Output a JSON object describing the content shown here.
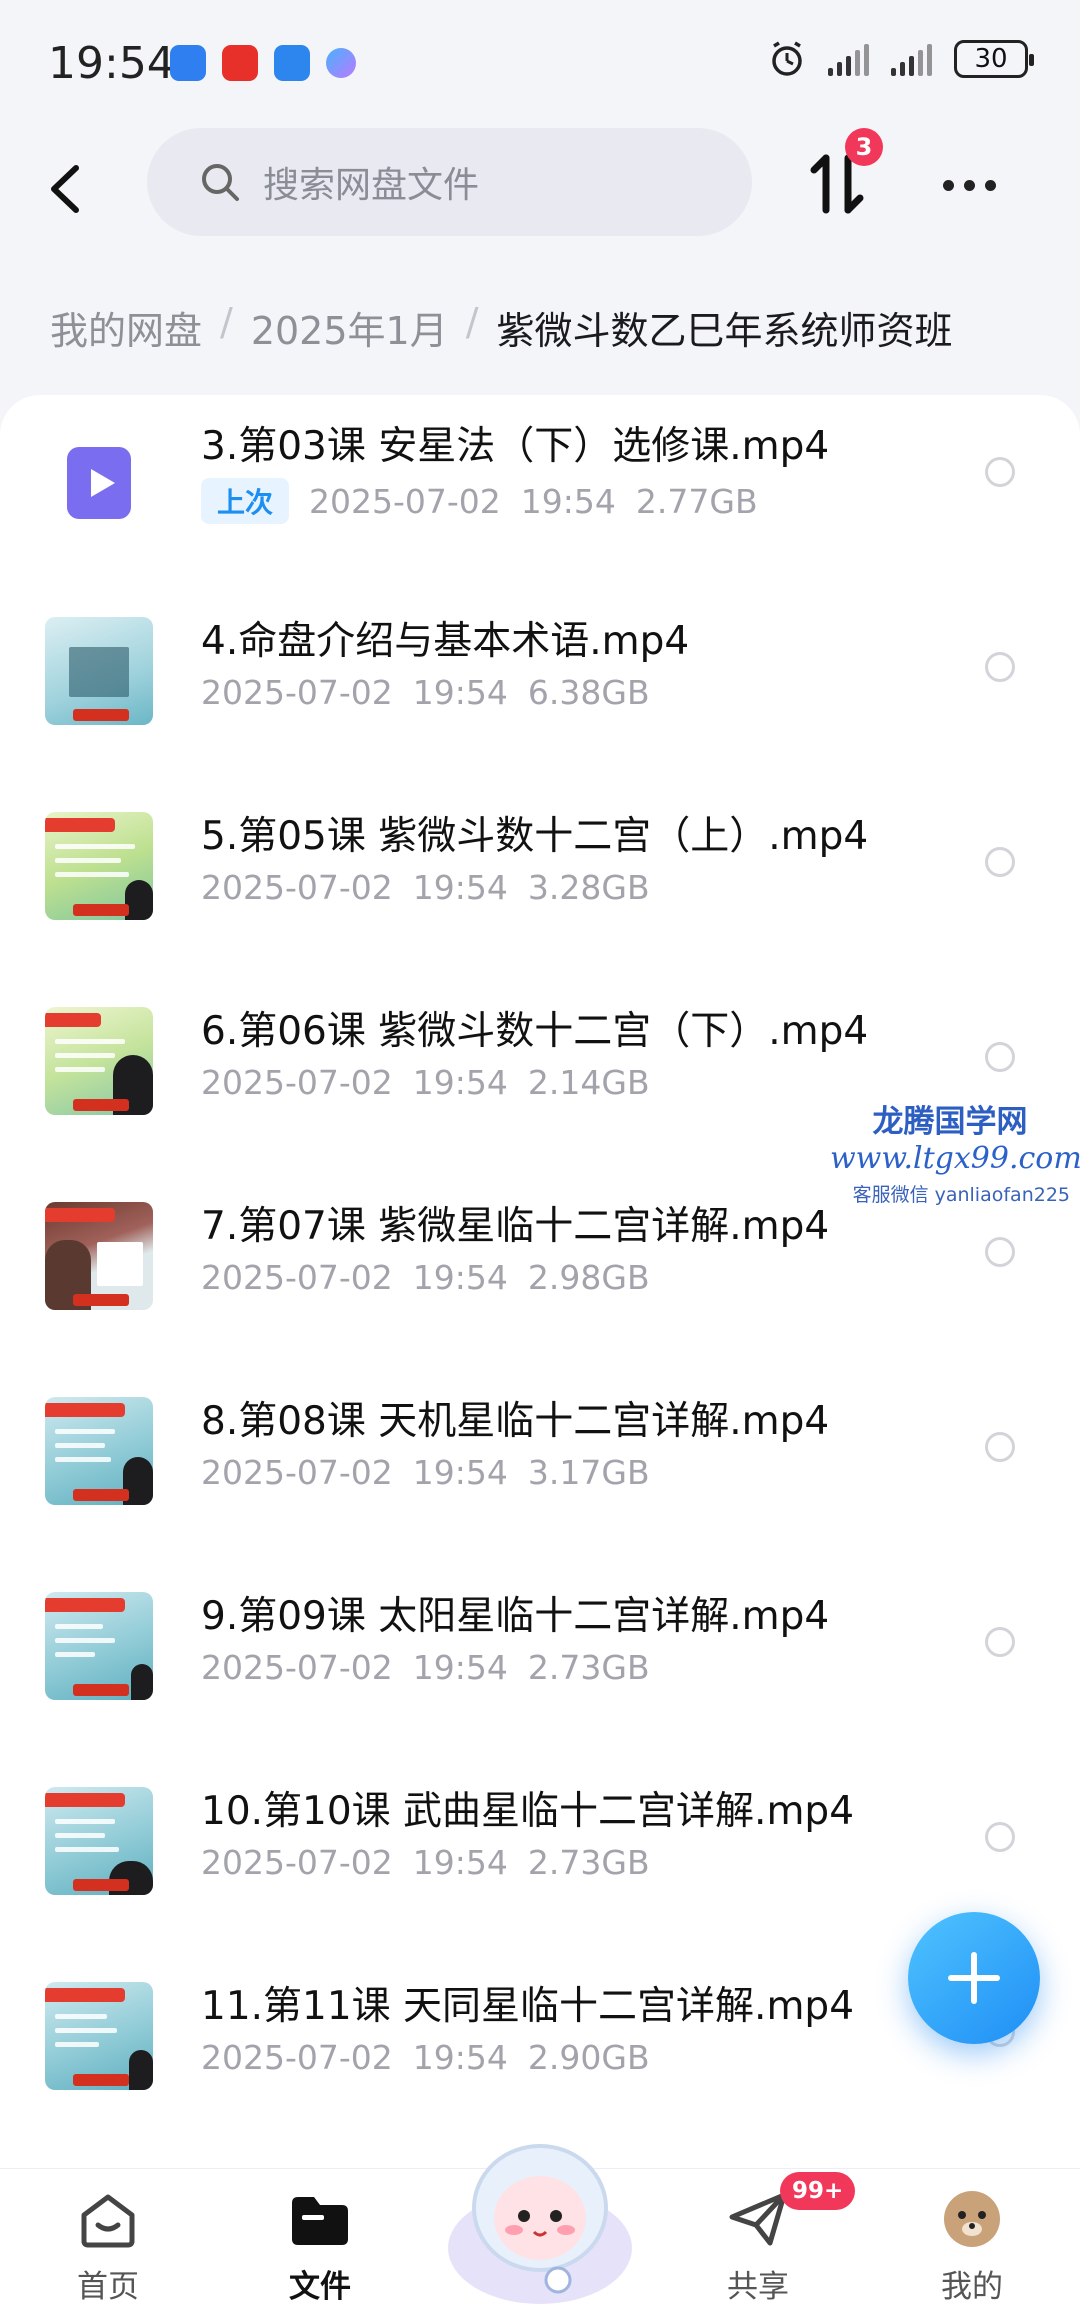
{
  "status_bar": {
    "time": "19:54",
    "battery": "30"
  },
  "header": {
    "search_placeholder": "搜索网盘文件",
    "transfer_badge": "3"
  },
  "breadcrumb": {
    "items": [
      "我的网盘",
      "2025年1月",
      "紫微斗数乙巳年系统师资班"
    ],
    "separator": "/"
  },
  "files": [
    {
      "name": "3.第03课 安星法（下）选修课.mp4",
      "tag": "上次",
      "date": "2025-07-02",
      "time": "19:54",
      "size": "2.77GB",
      "thumb": "video-icon"
    },
    {
      "name": "4.命盘介绍与基本术语.mp4",
      "date": "2025-07-02",
      "time": "19:54",
      "size": "6.38GB",
      "thumb": "thumbnail"
    },
    {
      "name": "5.第05课 紫微斗数十二宫（上）.mp4",
      "date": "2025-07-02",
      "time": "19:54",
      "size": "3.28GB",
      "thumb": "thumbnail"
    },
    {
      "name": "6.第06课 紫微斗数十二宫（下）.mp4",
      "date": "2025-07-02",
      "time": "19:54",
      "size": "2.14GB",
      "thumb": "thumbnail"
    },
    {
      "name": "7.第07课 紫微星临十二宫详解.mp4",
      "date": "2025-07-02",
      "time": "19:54",
      "size": "2.98GB",
      "thumb": "thumbnail"
    },
    {
      "name": "8.第08课 天机星临十二宫详解.mp4",
      "date": "2025-07-02",
      "time": "19:54",
      "size": "3.17GB",
      "thumb": "thumbnail"
    },
    {
      "name": "9.第09课 太阳星临十二宫详解.mp4",
      "date": "2025-07-02",
      "time": "19:54",
      "size": "2.73GB",
      "thumb": "thumbnail"
    },
    {
      "name": "10.第10课 武曲星临十二宫详解.mp4",
      "date": "2025-07-02",
      "time": "19:54",
      "size": "2.73GB",
      "thumb": "thumbnail"
    },
    {
      "name": "11.第11课 天同星临十二宫详解.mp4",
      "date": "2025-07-02",
      "time": "19:54",
      "size": "2.90GB",
      "thumb": "thumbnail"
    }
  ],
  "watermark": {
    "line1": "龙腾国学网",
    "line2": "www.ltgx99.com",
    "line3": "客服微信 yanliaofan225"
  },
  "tabbar": {
    "items": [
      {
        "label": "首页",
        "icon": "home-icon"
      },
      {
        "label": "文件",
        "icon": "folder-icon"
      },
      {
        "label": "共享",
        "icon": "paper-plane-icon"
      },
      {
        "label": "我的",
        "icon": "avatar-icon"
      }
    ],
    "share_badge": "99+"
  },
  "colors": {
    "accent": "#1f8ef5",
    "badge": "#f2385a",
    "video_icon": "#7b6df0"
  }
}
